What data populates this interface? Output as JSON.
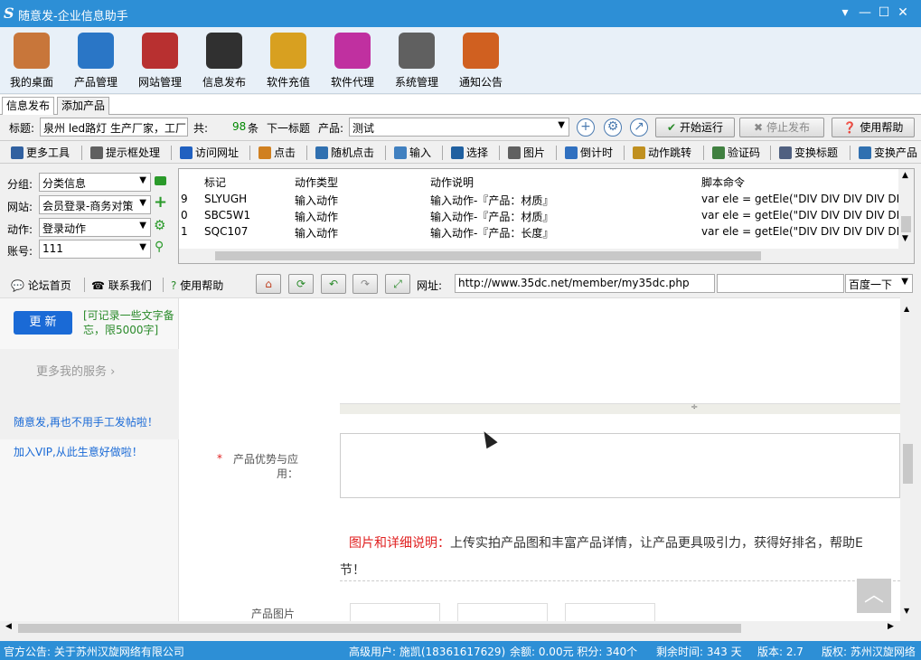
{
  "window": {
    "logo": "S",
    "title": "随意发-企业信息助手",
    "dropdown": "▾",
    "minimize": "—",
    "maximize": "☐",
    "close": "✕"
  },
  "toolbar": [
    {
      "label": "我的桌面",
      "icon": "house-icon",
      "color": "#c8763a"
    },
    {
      "label": "产品管理",
      "icon": "cloud-icon",
      "color": "#2a76c6"
    },
    {
      "label": "网站管理",
      "icon": "building-icon",
      "color": "#b83030"
    },
    {
      "label": "信息发布",
      "icon": "magic-wand-icon",
      "color": "#303030"
    },
    {
      "label": "软件充值",
      "icon": "bar-chart-icon",
      "color": "#d8a020"
    },
    {
      "label": "软件代理",
      "icon": "gift-icon",
      "color": "#c030a0"
    },
    {
      "label": "系统管理",
      "icon": "gear-icon",
      "color": "#606060"
    },
    {
      "label": "通知公告",
      "icon": "notepad-icon",
      "color": "#d06020"
    }
  ],
  "tabs": [
    "信息发布",
    "添加产品"
  ],
  "row1": {
    "title_label": "标题:",
    "title_value": "泉州 led路灯 生产厂家，工厂",
    "total_label": "共:",
    "total_count": "98",
    "total_unit": "条",
    "next_label": "下一标题",
    "product_label": "产品:",
    "product_value": "测试",
    "start": "开始运行",
    "stop": "停止发布",
    "help": "使用帮助"
  },
  "row2": [
    {
      "label": "更多工具",
      "color": "#3060a0"
    },
    {
      "label": "提示框处理",
      "color": "#606060"
    },
    {
      "label": "访问网址",
      "color": "#2060c0"
    },
    {
      "label": "点击",
      "color": "#d08020"
    },
    {
      "label": "随机点击",
      "color": "#3070b0"
    },
    {
      "label": "输入",
      "color": "#4080c0"
    },
    {
      "label": "选择",
      "color": "#2060a0"
    },
    {
      "label": "图片",
      "color": "#606060"
    },
    {
      "label": "倒计时",
      "color": "#3070c0"
    },
    {
      "label": "动作跳转",
      "color": "#c09020"
    },
    {
      "label": "验证码",
      "color": "#408040"
    },
    {
      "label": "变换标题",
      "color": "#506080"
    },
    {
      "label": "变换产品",
      "color": "#3070b0"
    }
  ],
  "left": {
    "group_label": "分组:",
    "group_value": "分类信息",
    "site_label": "网站:",
    "site_value": "会员登录-商务对策",
    "action_label": "动作:",
    "action_value": "登录动作",
    "account_label": "账号:",
    "account_value": "111"
  },
  "grid": {
    "headers": [
      "标记",
      "动作类型",
      "动作说明",
      "脚本命令"
    ],
    "rows": [
      {
        "idx": "9",
        "mark": "SLYUGH",
        "type": "输入动作",
        "desc": "输入动作-『产品：材质』",
        "cmd": "var ele = getEle(\"DIV DIV DIV DIV DIV"
      },
      {
        "idx": "0",
        "mark": "SBC5W1",
        "type": "输入动作",
        "desc": "输入动作-『产品：材质』",
        "cmd": "var ele = getEle(\"DIV DIV DIV DIV DIV"
      },
      {
        "idx": "1",
        "mark": "SQC107",
        "type": "输入动作",
        "desc": "输入动作-『产品：长度』",
        "cmd": "var ele = getEle(\"DIV DIV DIV DIV DIV"
      }
    ]
  },
  "row3": {
    "forum": "论坛首页",
    "contact": "联系我们",
    "help": "使用帮助",
    "url_label": "网址:",
    "url": "http://www.35dc.net/member/my35dc.php",
    "search_engine": "百度一下"
  },
  "page": {
    "update_btn": "更 新",
    "memo": "[可记录一些文字备忘，限5000字]",
    "more_services": "更多我的服务",
    "promo1": "随意发,再也不用手工发帖啦！",
    "promo2": "加入VIP,从此生意好做啦！",
    "required": "*",
    "field_label": "产品优势与应用：",
    "img_title": "图片和详细说明：",
    "img_desc": "上传实拍产品图和丰富产品详情，让产品更具吸引力，获得好排名，帮助E",
    "img_desc2": "节！",
    "product_img": "产品图片"
  },
  "status": {
    "announce": "官方公告: 关于苏州汉旋网络有限公司",
    "user": "高级用户: 施凯(18361617629)",
    "balance": "余额: 0.00元 积分: 340个",
    "remain": "剩余时间: 343 天",
    "version": "版本: 2.7",
    "copyright": "版权: 苏州汉旋网络"
  }
}
